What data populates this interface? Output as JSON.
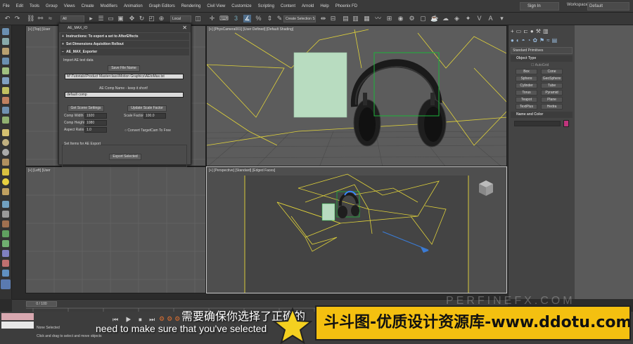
{
  "menu": [
    "File",
    "Edit",
    "Tools",
    "Group",
    "Views",
    "Create",
    "Modifiers",
    "Animation",
    "Graph Editors",
    "Rendering",
    "Civil View",
    "Customize",
    "Scripting",
    "Content",
    "Arnold",
    "Help",
    "Phoenix FD"
  ],
  "signin": "Sign In",
  "workspaces_label": "Workspaces:",
  "workspaces_value": "Default",
  "toolbar": {
    "filter": "All",
    "refcoord": "Local",
    "selset": "Create Selection Se"
  },
  "viewports": {
    "top": "[+] [Top] [User",
    "camera": "[+] [PhysCamera001] [User Defined] [Default Shading]",
    "left": "[+] [Left] [User",
    "persp": "[+] [Perspective] [Standard] [Edged Faces]"
  },
  "ae_panel": {
    "title": "AE_MAX_IO",
    "roll1": "Instructions: To export a set to AfterEffects",
    "roll2": "Set Dimensions Aquisition Rollout",
    "roll3": "AE_MAX_Exporter",
    "import_label": "Import AE text data",
    "save_btn": "Save File Name",
    "path": "M:\\Tutorials\\Product Masterclass\\Motion Graphics\\AEtoMax.txt",
    "comp_hint": "AE Comp Name - keep it short!",
    "comp_name": "default comp",
    "get_scene": "Get Scene Settings",
    "update_scale": "Update Scale Factor",
    "comp_width_lbl": "Comp Width",
    "comp_width": "1920",
    "scale_factor_lbl": "Scale Factor",
    "scale_factor": "100.0",
    "comp_height_lbl": "Comp Height",
    "comp_height": "1080",
    "aspect_lbl": "Aspect Ratio",
    "aspect": "1.0",
    "convert_cam": "Convert TargetCam To Free",
    "set_items": "Set Items for AE Export",
    "export_btn": "Export Selected"
  },
  "command_panel": {
    "dropdown": "Standard Primitives",
    "object_type": "Object Type",
    "autogrid": "AutoGrid",
    "buttons": [
      "Box",
      "Cone",
      "Sphere",
      "GeoSphere",
      "Cylinder",
      "Tube",
      "Torus",
      "Pyramid",
      "Teapot",
      "Plane",
      "TextPlus",
      "Hedra"
    ],
    "name_color": "Name and Color"
  },
  "timeline": {
    "frame": "0 / 100"
  },
  "status": {
    "none_selected": "None Selected",
    "hint": "Click and drag to select and move objects"
  },
  "subtitle_cn": "需要确保你选择了正确的",
  "subtitle_en": "need to make sure that you've selected",
  "banner": "斗斗图-优质设计资源库-www.ddotu.com",
  "watermark": "PERFINEFX.COM"
}
